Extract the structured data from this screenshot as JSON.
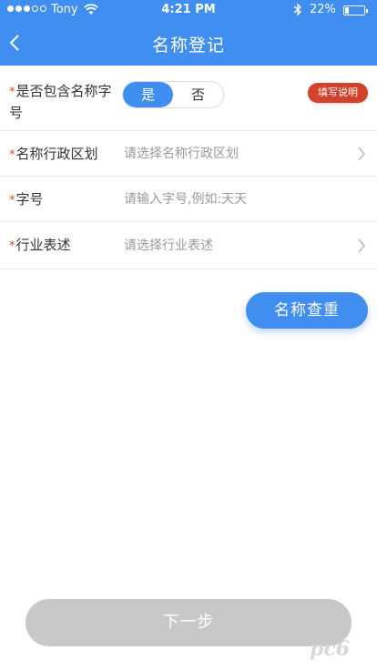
{
  "status_bar": {
    "carrier": "Tony",
    "time": "4:21 PM",
    "battery": "22%",
    "battery_level": 0.22
  },
  "nav": {
    "title": "名称登记"
  },
  "form": {
    "row1": {
      "required_mark": "*",
      "label": "是否包含名称字号",
      "options": [
        "是",
        "否"
      ],
      "selected": "是",
      "help_label": "填写说明"
    },
    "row2": {
      "required_mark": "*",
      "label": "名称行政区划",
      "placeholder": "请选择名称行政区划"
    },
    "row3": {
      "required_mark": "*",
      "label": "字号",
      "placeholder": "请输入字号,例如:天天"
    },
    "row4": {
      "required_mark": "*",
      "label": "行业表述",
      "placeholder": "请选择行业表述"
    }
  },
  "actions": {
    "check_label": "名称查重",
    "next_label": "下一步"
  },
  "colors": {
    "primary": "#3f8ef0",
    "required": "#e0452c",
    "badge": "#d2422a",
    "disabled": "#c8c8c8"
  },
  "watermark": "pc6"
}
